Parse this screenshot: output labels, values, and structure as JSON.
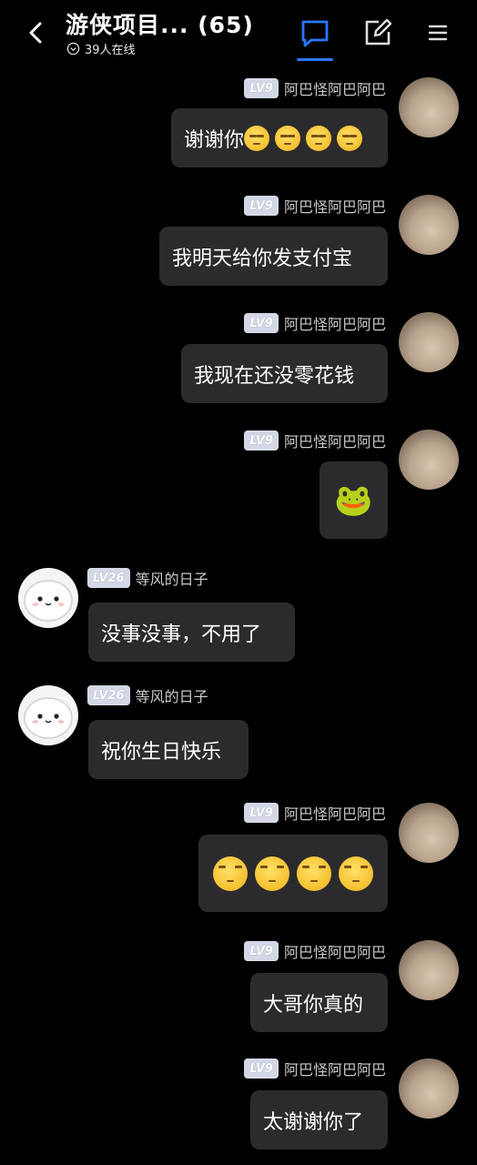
{
  "header": {
    "title": "游侠项目...  (65)",
    "online_text": "39人在线"
  },
  "users": {
    "me": {
      "name": "阿巴怪阿巴阿巴",
      "level": "LV9"
    },
    "other": {
      "name": "等风的日子",
      "level": "LV26"
    }
  },
  "messages": [
    {
      "sender": "me",
      "text": "谢谢你",
      "emoji_count": 4
    },
    {
      "sender": "me",
      "text": "我明天给你发支付宝"
    },
    {
      "sender": "me",
      "text": "我现在还没零花钱"
    },
    {
      "sender": "me",
      "text": "🐸"
    },
    {
      "sender": "other",
      "text": "没事没事，不用了"
    },
    {
      "sender": "other",
      "text": "祝你生日快乐"
    },
    {
      "sender": "me",
      "text": "",
      "emoji_count": 4
    },
    {
      "sender": "me",
      "text": "大哥你真的"
    },
    {
      "sender": "me",
      "text": "太谢谢你了"
    }
  ],
  "colors": {
    "accent": "#2a78ff",
    "bubble": "#2b2b2d",
    "background": "#000000"
  },
  "icons": {
    "back": "chevron-left-icon",
    "chat": "chat-bubble-icon",
    "edit": "edit-icon",
    "menu": "menu-icon",
    "online": "chevron-circle-icon"
  }
}
